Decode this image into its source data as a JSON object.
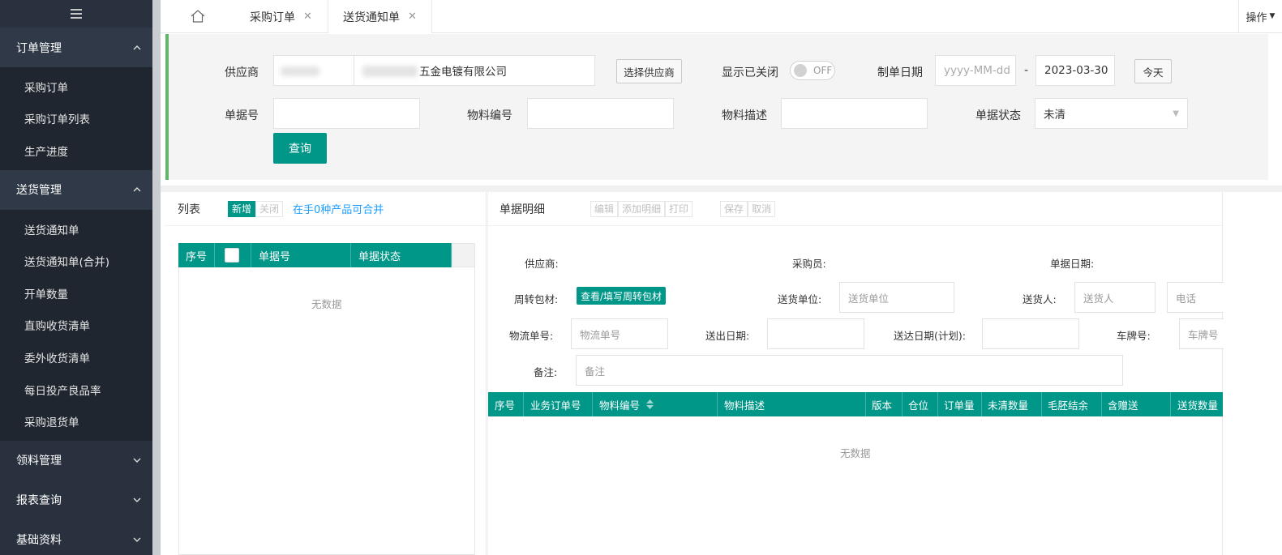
{
  "sidebar": {
    "menu_icon": "hamburger-icon",
    "groups": [
      {
        "label": "订单管理",
        "items": [
          "采购订单",
          "采购订单列表",
          "生产进度"
        ]
      },
      {
        "label": "送货管理",
        "items": [
          "送货通知单",
          "送货通知单(合并)",
          "开单数量",
          "直购收货清单",
          "委外收货清单",
          "每日投产良品率",
          "采购退货单"
        ]
      },
      {
        "label": "领料管理"
      },
      {
        "label": "报表查询"
      },
      {
        "label": "基础资料"
      }
    ]
  },
  "tabs": {
    "home_icon": "home-icon",
    "items": [
      {
        "label": "采购订单"
      },
      {
        "label": "送货通知单"
      }
    ],
    "operations": "操作"
  },
  "filter": {
    "supplier_label": "供应商",
    "supplier_name": "五金电镀有限公司",
    "select_supplier": "选择供应商",
    "show_closed_label": "显示已关闭",
    "switch_text": "OFF",
    "date_label": "制单日期",
    "date_from_placeholder": "yyyy-MM-dd",
    "date_dash": "-",
    "date_to": "2023-03-30",
    "today": "今天",
    "doc_no_label": "单据号",
    "material_no_label": "物料编号",
    "material_desc_label": "物料描述",
    "doc_status_label": "单据状态",
    "doc_status_value": "未清",
    "query": "查询"
  },
  "list_panel": {
    "title": "列表",
    "btn_new": "新增",
    "btn_close": "关闭",
    "merge_hint": "在手0种产品可合并",
    "columns": [
      "序号",
      "",
      "单据号",
      "单据状态"
    ],
    "empty": "无数据"
  },
  "detail_panel": {
    "title": "单据明细",
    "buttons": [
      "编辑",
      "添加明细",
      "打印"
    ],
    "buttons2": [
      "保存",
      "取消"
    ],
    "supplier_label": "供应商:",
    "buyer_label": "采购员:",
    "date_label": "单据日期:",
    "packing_label": "周转包材:",
    "packing_btn": "查看/填写周转包材",
    "delivery_unit_label": "送货单位:",
    "delivery_unit_placeholder": "送货单位",
    "deliverer_label": "送货人:",
    "deliverer_placeholder": "送货人",
    "phone_placeholder": "电话",
    "logistics_label": "物流单号:",
    "logistics_placeholder": "物流单号",
    "ship_date_label": "送出日期:",
    "arrive_date_label": "送达日期(计划):",
    "plate_label": "车牌号:",
    "plate_placeholder": "车牌号",
    "remark_label": "备注:",
    "remark_placeholder": "备注",
    "columns": [
      "序号",
      "业务订单号",
      "物料编号",
      "物料描述",
      "版本",
      "仓位",
      "订单量",
      "未清数量",
      "毛胚结余",
      "含赠送",
      "送货数量"
    ],
    "empty": "无数据"
  }
}
